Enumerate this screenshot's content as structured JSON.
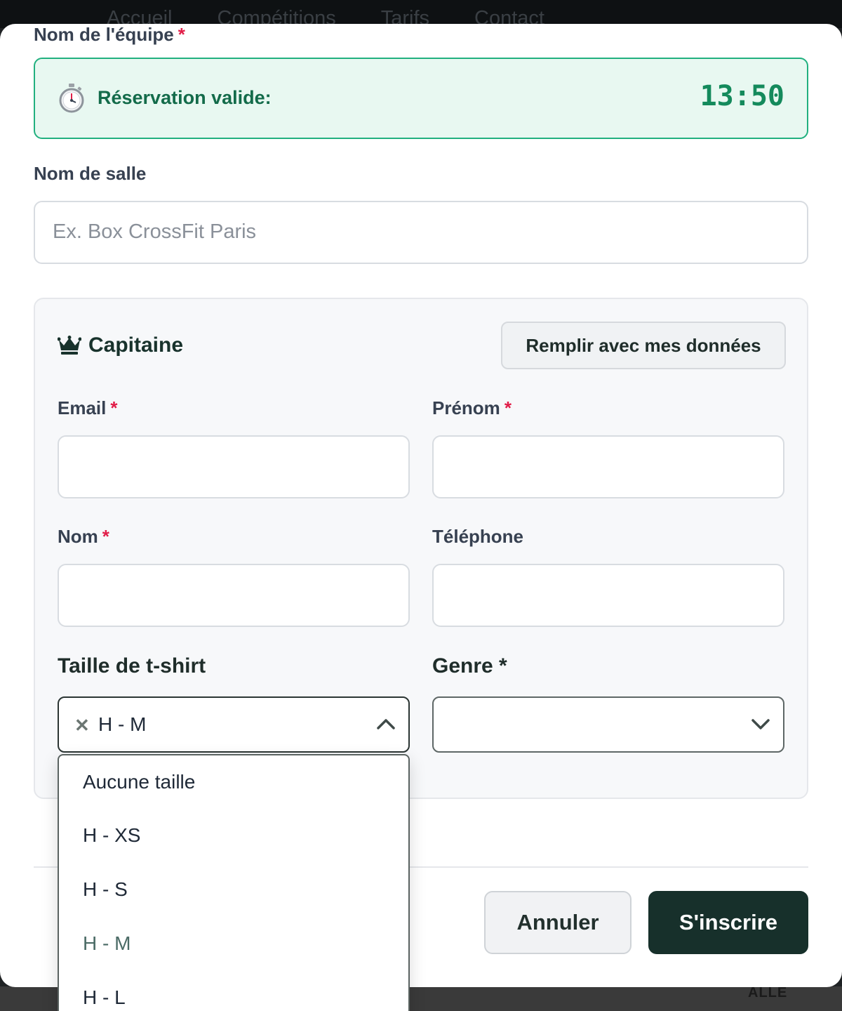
{
  "nav": {
    "items": [
      "Accueil",
      "Compétitions",
      "Tarifs",
      "Contact"
    ]
  },
  "backdrop": {
    "corner_text": "ALLE"
  },
  "form": {
    "team_name_label": "Nom de l'équipe",
    "required_mark": "*",
    "timer": {
      "label": "Réservation valide:",
      "value": "13:50",
      "icon": "stopwatch-icon"
    },
    "gym_label": "Nom de salle",
    "gym_placeholder": "Ex. Box CrossFit Paris"
  },
  "captain": {
    "title": "Capitaine",
    "icon": "crown-icon",
    "fill_button": "Remplir avec mes données",
    "email_label": "Email",
    "firstname_label": "Prénom",
    "lastname_label": "Nom",
    "phone_label": "Téléphone",
    "tshirt_label": "Taille de t-shirt",
    "tshirt_value": "H - M",
    "gender_label": "Genre *",
    "gender_value": ""
  },
  "tshirt_options": [
    {
      "label": "Aucune taille"
    },
    {
      "label": "H - XS"
    },
    {
      "label": "H - S"
    },
    {
      "label": "H - M"
    },
    {
      "label": "H - L"
    }
  ],
  "actions": {
    "cancel": "Annuler",
    "submit": "S'inscrire"
  },
  "colors": {
    "accent_green": "#21b07f",
    "primary_dark": "#17302b",
    "required_red": "#e11d48"
  }
}
